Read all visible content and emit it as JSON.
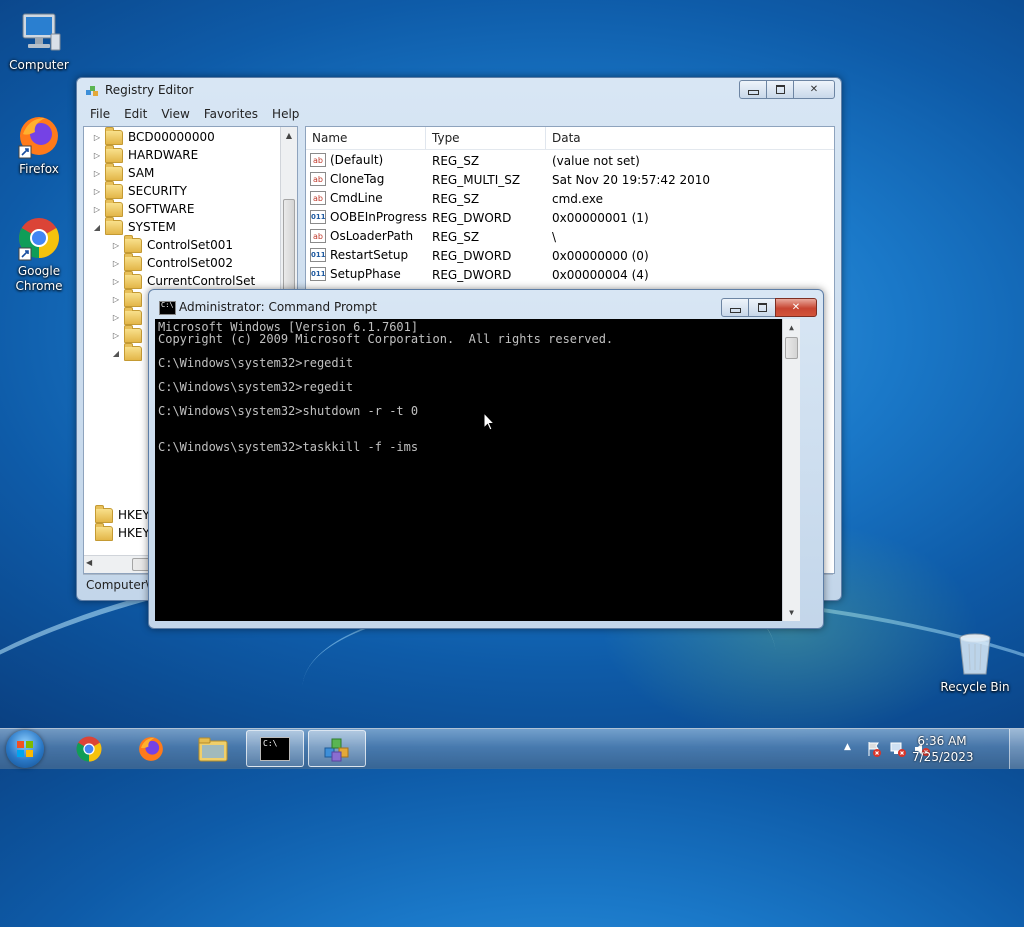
{
  "desktop": {
    "icons": [
      {
        "label": "Computer",
        "icon": "computer-icon"
      },
      {
        "label": "Firefox",
        "icon": "firefox-icon"
      },
      {
        "label": "Google Chrome",
        "icon": "chrome-icon"
      },
      {
        "label": "Recycle Bin",
        "icon": "recycle-bin-icon"
      }
    ]
  },
  "regedit": {
    "title": "Registry Editor",
    "menu": [
      "File",
      "Edit",
      "View",
      "Favorites",
      "Help"
    ],
    "tree": [
      "BCD00000000",
      "HARDWARE",
      "SAM",
      "SECURITY",
      "SOFTWARE",
      "SYSTEM",
      "ControlSet001",
      "ControlSet002",
      "CurrentControlSet"
    ],
    "tree_bottom": [
      "HKEY_U",
      "HKEY_C"
    ],
    "columns": [
      "Name",
      "Type",
      "Data"
    ],
    "values": [
      {
        "name": "(Default)",
        "type": "REG_SZ",
        "data": "(value not set)",
        "icon": "string-value-icon"
      },
      {
        "name": "CloneTag",
        "type": "REG_MULTI_SZ",
        "data": "Sat Nov 20 19:57:42 2010",
        "icon": "string-value-icon"
      },
      {
        "name": "CmdLine",
        "type": "REG_SZ",
        "data": "cmd.exe",
        "icon": "string-value-icon"
      },
      {
        "name": "OOBEInProgress",
        "type": "REG_DWORD",
        "data": "0x00000001 (1)",
        "icon": "binary-value-icon"
      },
      {
        "name": "OsLoaderPath",
        "type": "REG_SZ",
        "data": "\\",
        "icon": "string-value-icon"
      },
      {
        "name": "RestartSetup",
        "type": "REG_DWORD",
        "data": "0x00000000 (0)",
        "icon": "binary-value-icon"
      },
      {
        "name": "SetupPhase",
        "type": "REG_DWORD",
        "data": "0x00000004 (4)",
        "icon": "binary-value-icon"
      }
    ],
    "status": "Computer\\H"
  },
  "cmd": {
    "title": "Administrator: Command Prompt",
    "icon_text": "C:\\",
    "lines": [
      "Microsoft Windows [Version 6.1.7601]",
      "Copyright (c) 2009 Microsoft Corporation.  All rights reserved.",
      "C:\\Windows\\system32>regedit",
      "C:\\Windows\\system32>regedit",
      "C:\\Windows\\system32>shutdown -r -t 0",
      "C:\\Windows\\system32>taskkill -f -ims"
    ]
  },
  "taskbar": {
    "buttons": [
      "start-orb",
      "chrome",
      "firefox",
      "explorer",
      "command-prompt",
      "registry-editor"
    ],
    "time": "6:36 AM",
    "date": "7/25/2023"
  },
  "colors": {
    "desktop_blue": "#1a78c8",
    "console_bg": "#000000",
    "console_fg": "#c0c0c0",
    "close_red": "#c74531"
  }
}
